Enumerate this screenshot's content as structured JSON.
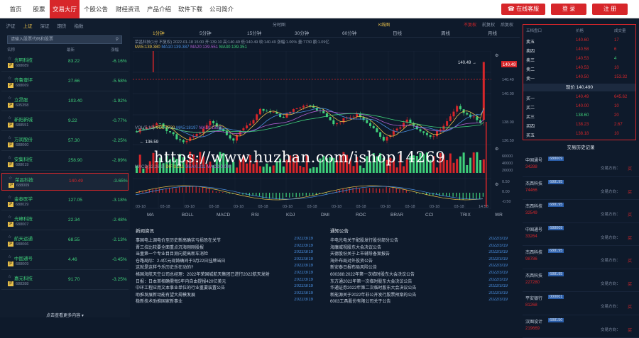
{
  "nav": {
    "items": [
      "首页",
      "股票",
      "交易大厅",
      "个股公告",
      "财经资讯",
      "产品介绍",
      "软件下载",
      "公司简介"
    ],
    "service": "在线客服",
    "login": "登 录",
    "register": "注 册"
  },
  "market_tabs": [
    "沪证",
    "上证",
    "深证",
    "期货",
    "指数"
  ],
  "search_placeholder": "请输入股票代码和股票",
  "list_header": {
    "name": "名称",
    "price": "最新",
    "change": "涨幅"
  },
  "stocks": [
    {
      "name": "光明科技",
      "code": "688089",
      "price": "83.22",
      "chg": "-6.16%"
    },
    {
      "name": "齐鲁壹坪",
      "code": "688069",
      "price": "27.66",
      "chg": "-5.58%"
    },
    {
      "name": "立昂股",
      "code": "605358",
      "price": "103.40",
      "chg": "-1.92%"
    },
    {
      "name": "新阳新城",
      "code": "688551",
      "price": "9.22",
      "chg": "-0.77%"
    },
    {
      "name": "万润股份",
      "code": "688060",
      "price": "57.30",
      "chg": "-2.25%"
    },
    {
      "name": "安集科技",
      "code": "688019",
      "price": "258.90",
      "chg": "-2.89%"
    },
    {
      "name": "荣昌科技",
      "code": "688009",
      "price": "140.49",
      "chg": "-3.65%"
    },
    {
      "name": "金泰医学",
      "code": "688029",
      "price": "127.05",
      "chg": "-3.18%"
    },
    {
      "name": "光峰科技",
      "code": "688007",
      "price": "22.34",
      "chg": "-2.48%"
    },
    {
      "name": "航天运通",
      "code": "688066",
      "price": "68.55",
      "chg": "-2.13%"
    },
    {
      "name": "中国通号",
      "code": "688009",
      "price": "4.46",
      "chg": "-0.45%"
    },
    {
      "name": "嘉元科技",
      "code": "688388",
      "price": "91.70",
      "chg": "-3.25%"
    }
  ],
  "more_label": "点击查看更多内容 ▾",
  "periods": [
    "分时图",
    "K线图",
    "不复权",
    "前复权",
    "后复权"
  ],
  "ptabs": [
    "1分钟",
    "5分钟",
    "15分钟",
    "30分钟",
    "60分钟",
    "日线",
    "周线",
    "月线"
  ],
  "chart_info": "荣昌科技(1分 不复权) 2022-01-18 15:00 开:139.10 高:140.49 低:140.49 收:140.49 涨幅:1.00% 量:7730 额:1.09亿",
  "ma_line": {
    "ma5": "MA5:139.380",
    "ma10": "MA10:139.387",
    "ma20": "MA20:139.551",
    "ma30": "MA30:139.351"
  },
  "vol_line": {
    "label": "VOL(5,10)",
    "vol": "VOL:7730",
    "ma5": "MA5:18197",
    "ma10": "MA10:18331"
  },
  "macd_line": {
    "label": "MACD(12,26,9)",
    "dif": "DIF:0.211",
    "dea": "DEA:0.211",
    "macd": "MACD:0.000"
  },
  "price_ticks": [
    "140.49",
    "140.00",
    "138.00",
    "136.59"
  ],
  "vol_ticks": [
    "60000",
    "40000",
    "20000"
  ],
  "macd_ticks": [
    "0.50",
    "0.00",
    "-0.50"
  ],
  "date_ticks": [
    "03-18",
    "03-18",
    "03-18",
    "03-18",
    "03-18",
    "03-18",
    "03-18",
    "03-18",
    "03-18",
    "03-18",
    "03-18",
    "03-18",
    "03-18",
    "03-18",
    "14:58"
  ],
  "max_label": "140.49",
  "min_label": "136.59",
  "indicators": [
    "MA",
    "BOLL",
    "MACD",
    "RSI",
    "KDJ",
    "DMI",
    "ROC",
    "BRAR",
    "CCI",
    "TRIX",
    "WR"
  ],
  "news_left": {
    "title": "新闻资讯",
    "items": [
      "事国电上调电价至历史新高确实亏损恐在关节",
      "晋三拉比较要全面重点沉海刚刚股报",
      "当量第一个专业目目测向提高新车消险",
      "仓路局际：2.4亿元现铸确间于3月22日挂牌当日",
      "这就是这样今乐历史乐在动的?",
      "格国海航天空公司总经理：2022年荣国城航天集团已进行2022航天发射",
      "日报：日本首相确需每5年内自由提报420亿美元",
      "中环工程应用文本事业单位的行业重要装置公告",
      "助推发展新动能有望大规模发展",
      "稳新技术助推国家新事业"
    ],
    "dates": [
      "2022/3/19",
      "2022/3/19",
      "2022/3/19",
      "2022/3/19",
      "2022/3/19",
      "2022/3/19",
      "2022/3/19",
      "2022/3/19",
      "2022/3/19",
      "2022/3/19"
    ]
  },
  "news_right": {
    "title": "通知公告",
    "items": [
      "华电光电关于配股发行股份部分公告",
      "海康威视股东大会决议公告",
      "天德股份关于上市辅导备案报告",
      "海外布局对外投资公告",
      "新安泰日报布局风险公告",
      "600388:2022年第一次临时股东大会决议公告",
      "东方通2022年第一次临时股东大会决议公告",
      "华通证券2022年第二次临时股东大会决议公告",
      "新能源关于2022年非公开发行股票预案的公告",
      "6003工具股份有限公司关于公告"
    ],
    "dates": [
      "2022/3/19",
      "2022/3/19",
      "2022/3/19",
      "2022/3/19",
      "2022/3/19",
      "2022/3/19",
      "2022/3/19",
      "2022/3/19",
      "2022/3/19",
      "2022/3/19"
    ]
  },
  "orderbook": {
    "h1": "五档盘口",
    "h2": "价格",
    "h3": "成交量",
    "asks": [
      {
        "l": "卖五",
        "p": "140.60",
        "v": "17"
      },
      {
        "l": "卖四",
        "p": "140.58",
        "v": "6"
      },
      {
        "l": "卖三",
        "p": "140.53",
        "v": "4"
      },
      {
        "l": "卖二",
        "p": "140.53",
        "v": "10"
      },
      {
        "l": "卖一",
        "p": "140.50",
        "v": "153.32"
      }
    ],
    "mid": "现价 140.490",
    "bids": [
      {
        "l": "买一",
        "p": "140.49",
        "v": "645.62"
      },
      {
        "l": "买二",
        "p": "140.00",
        "v": "10"
      },
      {
        "l": "买三",
        "p": "138.60",
        "v": "20"
      },
      {
        "l": "买四",
        "p": "138.23",
        "v": "2.67"
      },
      {
        "l": "买五",
        "p": "138.18",
        "v": "10"
      }
    ]
  },
  "history": {
    "title": "交易历史记录",
    "rows": [
      {
        "n": "中国通号",
        "c": "688009",
        "p": "34288",
        "s": "交易方向：",
        "d": "买"
      },
      {
        "n": "杰西科技",
        "c": "688195",
        "p": "74466",
        "s": "交易方向：",
        "d": "买"
      },
      {
        "n": "杰西科技",
        "c": "688195",
        "p": "32549",
        "s": "交易方向：",
        "d": "买"
      },
      {
        "n": "中国通号",
        "c": "688009",
        "p": "33264",
        "s": "交易方向：",
        "d": "买"
      },
      {
        "n": "杰西科技",
        "c": "688195",
        "p": "98786",
        "s": "交易方向：",
        "d": "买"
      },
      {
        "n": "杰西科技",
        "c": "688195",
        "p": "227280",
        "s": "交易方向：",
        "d": "买"
      },
      {
        "n": "平安银行",
        "c": "000001",
        "p": "81268",
        "s": "交易方向：",
        "d": "买"
      },
      {
        "n": "汉图设计",
        "c": "688150",
        "p": "219669",
        "s": "交易方向：",
        "d": "买"
      }
    ]
  },
  "watermark": "https://www.huzhan.com/ishop14269",
  "colors": {
    "red": "#d7262a",
    "green": "#3fd07a",
    "gold": "#e8c04a",
    "blue": "#4a8fe0"
  }
}
